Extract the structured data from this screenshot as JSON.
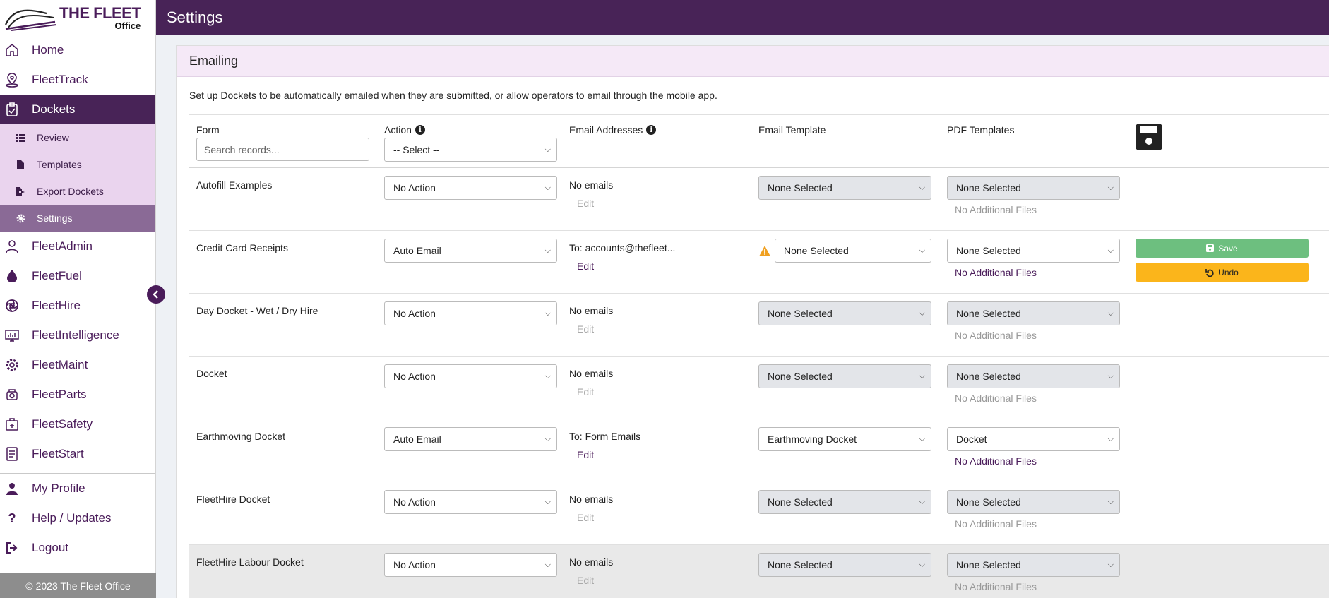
{
  "app": {
    "logo_main": "THE FLEET",
    "logo_sub": "Office",
    "page_title": "Settings"
  },
  "sidebar": {
    "items": [
      {
        "label": "Home",
        "icon": "home-icon"
      },
      {
        "label": "FleetTrack",
        "icon": "location-pin-icon"
      },
      {
        "label": "Dockets",
        "icon": "clipboard-check-icon",
        "active": true
      }
    ],
    "sub_items": [
      {
        "label": "Review",
        "icon": "list-icon"
      },
      {
        "label": "Templates",
        "icon": "file-icon"
      },
      {
        "label": "Export Dockets",
        "icon": "file-export-icon"
      },
      {
        "label": "Settings",
        "icon": "gear-icon",
        "active": true
      }
    ],
    "items2": [
      {
        "label": "FleetAdmin",
        "icon": "user-admin-icon"
      },
      {
        "label": "FleetFuel",
        "icon": "fuel-drop-icon"
      },
      {
        "label": "FleetHire",
        "icon": "hire-swirl-icon"
      },
      {
        "label": "FleetIntelligence",
        "icon": "monitor-chart-icon"
      },
      {
        "label": "FleetMaint",
        "icon": "maintenance-gear-icon"
      },
      {
        "label": "FleetParts",
        "icon": "parts-icon"
      },
      {
        "label": "FleetSafety",
        "icon": "safety-icon"
      },
      {
        "label": "FleetStart",
        "icon": "checklist-icon"
      }
    ],
    "bottom": [
      {
        "label": "My Profile",
        "icon": "user-icon"
      },
      {
        "label": "Help / Updates",
        "icon": "question-icon"
      },
      {
        "label": "Logout",
        "icon": "logout-icon"
      }
    ],
    "footer": "2023 The Fleet Office"
  },
  "panel": {
    "title": "Emailing",
    "description": "Set up Dockets to be automatically emailed when they are submitted, or allow operators to email through the mobile app.",
    "headers": {
      "form": "Form",
      "action": "Action",
      "emails": "Email Addresses",
      "email_template": "Email Template",
      "pdf_templates": "PDF Templates"
    },
    "search_placeholder": "Search records...",
    "action_filter": "-- Select --",
    "edit_label": "Edit",
    "save_label": "Save",
    "undo_label": "Undo",
    "rows": [
      {
        "form": "Autofill Examples",
        "action": "No Action",
        "emails": "No emails",
        "email_template": "None Selected",
        "pdf_template": "None Selected",
        "files": "No Additional Files"
      },
      {
        "form": "Credit Card Receipts",
        "action": "Auto Email",
        "emails": "To: accounts@thefleet...",
        "email_template": "None Selected",
        "pdf_template": "None Selected",
        "files": "No Additional Files"
      },
      {
        "form": "Day Docket - Wet / Dry Hire",
        "action": "No Action",
        "emails": "No emails",
        "email_template": "None Selected",
        "pdf_template": "None Selected",
        "files": "No Additional Files"
      },
      {
        "form": "Docket",
        "action": "No Action",
        "emails": "No emails",
        "email_template": "None Selected",
        "pdf_template": "None Selected",
        "files": "No Additional Files"
      },
      {
        "form": "Earthmoving Docket",
        "action": "Auto Email",
        "emails": "To: Form Emails",
        "email_template": "Earthmoving Docket",
        "pdf_template": "Docket",
        "files": "No Additional Files"
      },
      {
        "form": "FleetHire Docket",
        "action": "No Action",
        "emails": "No emails",
        "email_template": "None Selected",
        "pdf_template": "None Selected",
        "files": "No Additional Files"
      },
      {
        "form": "FleetHire Labour Docket",
        "action": "No Action",
        "emails": "No emails",
        "email_template": "None Selected",
        "pdf_template": "None Selected",
        "files": "No Additional Files"
      }
    ]
  },
  "colors": {
    "brand": "#482357",
    "save": "#6dbf7f",
    "undo": "#fbb51b",
    "warning": "#f0a020"
  }
}
